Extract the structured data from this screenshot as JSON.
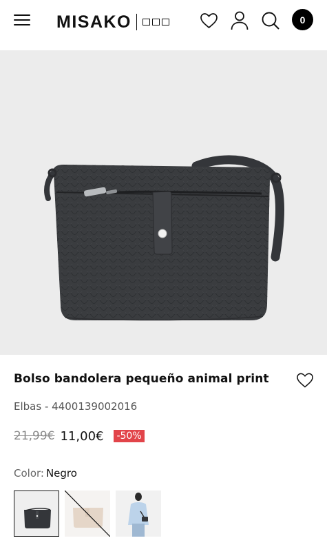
{
  "header": {
    "logo": "MISAKO",
    "cart_count": "0"
  },
  "product": {
    "title": "Bolso bandolera pequeño animal print",
    "brand": "Elbas",
    "ref_separator": " - ",
    "reference": "4400139002016",
    "old_price": "21,99€",
    "new_price": "11,00€",
    "discount": "-50%",
    "color_label": "Color:",
    "color_value": "Negro"
  },
  "colors": {
    "discount_bg": "#e2444a",
    "image_bg": "#ececec",
    "bag": "#3a3c3f"
  }
}
